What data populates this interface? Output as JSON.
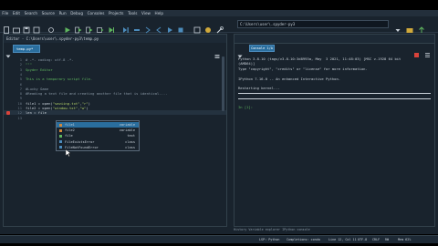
{
  "menubar": {
    "items": [
      "File",
      "Edit",
      "Search",
      "Source",
      "Run",
      "Debug",
      "Consoles",
      "Projects",
      "Tools",
      "View",
      "Help"
    ]
  },
  "toolbar": {
    "editor_path": "C:\\Users\\user\\.spyder-py3\\temp.py",
    "console_path": "C:\\Users\\user\\.spyder-py3"
  },
  "editor": {
    "title": "Editor - C:\\Users\\user\\.spyder-py3\\temp.py",
    "tab_label": "temp.py*",
    "lines": [
      {
        "n": "1",
        "text": "# -*- coding: utf-8 -*-",
        "cls": "c-comment"
      },
      {
        "n": "2",
        "text": "\"\"\"",
        "cls": "c-green"
      },
      {
        "n": "3",
        "text": "Spyder Editor",
        "cls": "c-green"
      },
      {
        "n": "4",
        "text": "",
        "cls": ""
      },
      {
        "n": "5",
        "text": "This is a temporary script file.",
        "cls": "c-green"
      },
      {
        "n": "6",
        "text": "",
        "cls": ""
      },
      {
        "n": "7",
        "text": "#Lucky Game",
        "cls": "c-comment"
      },
      {
        "n": "8",
        "text": "#Reading a text file and creating another file that is identical....",
        "cls": "c-comment"
      },
      {
        "n": "9",
        "text": "",
        "cls": ""
      },
      {
        "n": "10",
        "text": "file1 = open(\"saviing.txt\",\"r\")",
        "cls": "mixed"
      },
      {
        "n": "11",
        "text": "file2 = open(\"window.txt\",\"w\")",
        "cls": "mixed"
      },
      {
        "n": "12",
        "text": "len = file",
        "cls": ""
      },
      {
        "n": "13",
        "text": "",
        "cls": ""
      }
    ]
  },
  "autocomplete": {
    "items": [
      {
        "name": "file1",
        "type": "variable",
        "color": "#d0883b",
        "selected": true
      },
      {
        "name": "file2",
        "type": "variable",
        "color": "#d0883b",
        "selected": false
      },
      {
        "name": "file",
        "type": "text",
        "color": "#5fb65f",
        "selected": false
      },
      {
        "name": "FileExistsError",
        "type": "class",
        "color": "#4c8cbc",
        "selected": false
      },
      {
        "name": "FileNotFoundError",
        "type": "class",
        "color": "#4c8cbc",
        "selected": false
      }
    ]
  },
  "console": {
    "tab_label": "Console 1/A",
    "lines": [
      "Python 3.8.10 (tags/v3.8.10:3d8993a, May  3 2021, 11:48:03) [MSC v.1928 64 bit",
      "(AMD64)]",
      "Type \"copyright\", \"credits\" or \"license\" for more information.",
      "",
      "IPython 7.16.0 -- An enhanced Interactive Python.",
      "",
      "Restarting kernel..."
    ],
    "prompt": "In [1]:"
  },
  "bottom_tabs": "History   Variable explorer   IPython console",
  "status": {
    "lsp": "LSP: Python",
    "kernel": "Completions: conda",
    "line_col": "Line 12, Col 11",
    "encoding": "UTF-8",
    "eol": "CRLF",
    "rw": "RW",
    "mem": "Mem 62%"
  }
}
